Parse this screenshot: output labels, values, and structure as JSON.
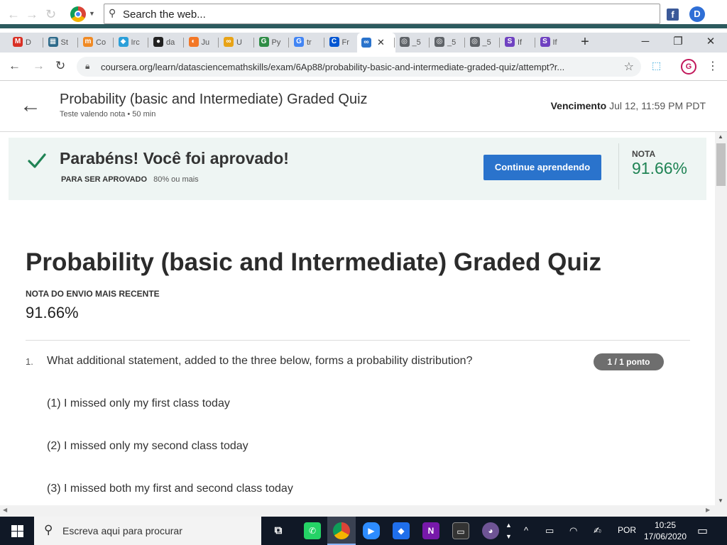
{
  "browser": {
    "search_placeholder": "Search the web...",
    "tabs": [
      {
        "icon": "gmail-icon",
        "label": "D",
        "color": "#d93025",
        "glyph": "M"
      },
      {
        "icon": "stats-icon",
        "label": "St",
        "color": "#2d6a8a",
        "glyph": "▦"
      },
      {
        "icon": "moodle-icon",
        "label": "Co",
        "color": "#f08a24",
        "glyph": "m"
      },
      {
        "icon": "shield-icon",
        "label": "Irc",
        "color": "#2b9fd9",
        "glyph": "◆"
      },
      {
        "icon": "github-icon",
        "label": "da",
        "color": "#222222",
        "glyph": "●"
      },
      {
        "icon": "jupyter-icon",
        "label": "Ju",
        "color": "#f37726",
        "glyph": "◐"
      },
      {
        "icon": "infinity-icon",
        "label": "U",
        "color": "#e8a317",
        "glyph": "∞"
      },
      {
        "icon": "geeks-icon",
        "label": "Py",
        "color": "#2f8d46",
        "glyph": "G"
      },
      {
        "icon": "google-icon",
        "label": "tr",
        "color": "#4285f4",
        "glyph": "G"
      },
      {
        "icon": "coursera-icon",
        "label": "Fr",
        "color": "#0056d2",
        "glyph": "C"
      },
      {
        "icon": "coursera-infinity-icon",
        "label": "",
        "color": "#2a73cc",
        "glyph": "∞"
      },
      {
        "icon": "globe-icon",
        "label": "_5",
        "color": "#5f6368",
        "glyph": "◎"
      },
      {
        "icon": "globe-icon",
        "label": "_5",
        "color": "#5f6368",
        "glyph": "◎"
      },
      {
        "icon": "globe-icon",
        "label": "_5",
        "color": "#5f6368",
        "glyph": "◎"
      },
      {
        "icon": "s-icon",
        "label": "If",
        "color": "#6f42c1",
        "glyph": "S"
      },
      {
        "icon": "s-icon",
        "label": "If",
        "color": "#6f42c1",
        "glyph": "S"
      }
    ],
    "active_tab_close": "✕",
    "new_tab": "+",
    "url": "coursera.org/learn/datasciencemathskills/exam/6Ap88/probability-basic-and-intermediate-graded-quiz/attempt?r...",
    "profile_initial": "G"
  },
  "header": {
    "title": "Probability (basic and Intermediate) Graded Quiz",
    "subtitle": "Teste valendo nota • 50 min",
    "due_label": "Vencimento",
    "due_value": "Jul 12, 11:59 PM PDT"
  },
  "banner": {
    "title": "Parabéns! Você foi aprovado!",
    "pass_label": "PARA SER APROVADO",
    "pass_value": "80% ou mais",
    "continue_label": "Continue aprendendo",
    "grade_label": "NOTA",
    "grade_value": "91.66%",
    "accent_color": "#1f8354"
  },
  "main": {
    "title": "Probability (basic and Intermediate) Graded Quiz",
    "recent_label": "NOTA DO ENVIO MAIS RECENTE",
    "recent_value": "91.66%",
    "question": {
      "number": "1.",
      "text": "What additional statement, added to the three below, forms a probability distribution?",
      "points": "1 / 1 ponto",
      "options": [
        "(1) I missed only my first class today",
        "(2) I missed only my second class today",
        "(3) I missed both my first and second class today"
      ]
    }
  },
  "taskbar": {
    "search_placeholder": "Escreva aqui para procurar",
    "language": "POR",
    "time": "10:25",
    "date": "17/06/2020"
  }
}
